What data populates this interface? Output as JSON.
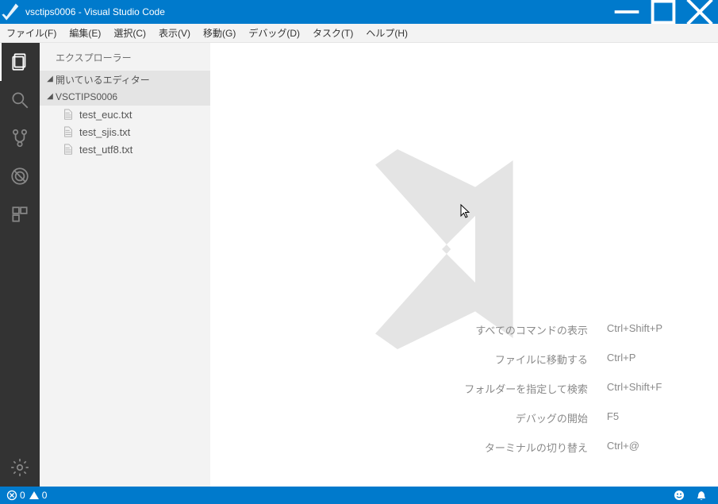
{
  "window": {
    "title": "vsctips0006 - Visual Studio Code"
  },
  "menu": {
    "file": "ファイル(F)",
    "edit": "編集(E)",
    "select": "選択(C)",
    "view": "表示(V)",
    "go": "移動(G)",
    "debug": "デバッグ(D)",
    "task": "タスク(T)",
    "help": "ヘルプ(H)"
  },
  "sidebar": {
    "title": "エクスプローラー",
    "section_open_editors": "開いているエディター",
    "section_folder": "VSCTIPS0006",
    "files": [
      "test_euc.txt",
      "test_sjis.txt",
      "test_utf8.txt"
    ]
  },
  "welcome": {
    "items": [
      {
        "label": "すべてのコマンドの表示",
        "key": "Ctrl+Shift+P"
      },
      {
        "label": "ファイルに移動する",
        "key": "Ctrl+P"
      },
      {
        "label": "フォルダーを指定して検索",
        "key": "Ctrl+Shift+F"
      },
      {
        "label": "デバッグの開始",
        "key": "F5"
      },
      {
        "label": "ターミナルの切り替え",
        "key": "Ctrl+@"
      }
    ]
  },
  "status": {
    "errors": "0",
    "warnings": "0"
  }
}
